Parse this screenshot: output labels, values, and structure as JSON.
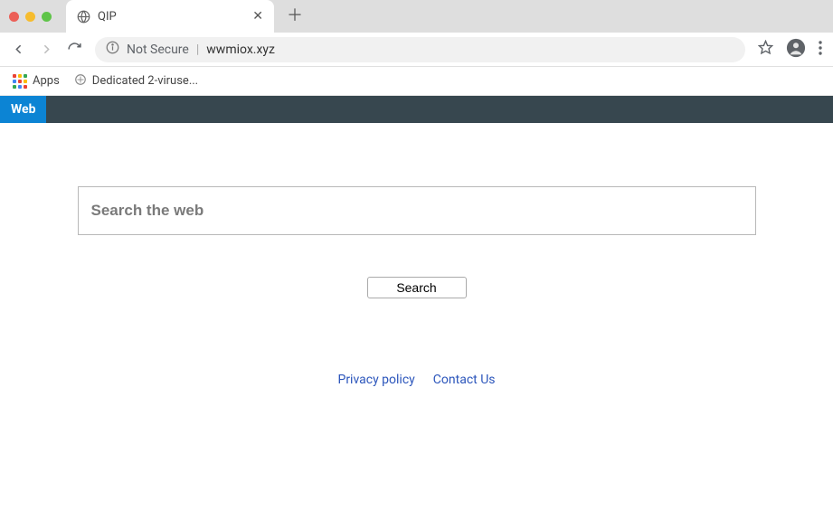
{
  "browser": {
    "tab_title": "QIP",
    "address": {
      "security_label": "Not Secure",
      "url": "wwmiox.xyz"
    },
    "bookmarks": {
      "apps_label": "Apps",
      "item1_label": "Dedicated 2-viruse..."
    }
  },
  "page": {
    "nav_tab": "Web",
    "search_placeholder": "Search the web",
    "search_button": "Search",
    "footer": {
      "privacy": "Privacy policy",
      "contact": "Contact Us"
    }
  }
}
